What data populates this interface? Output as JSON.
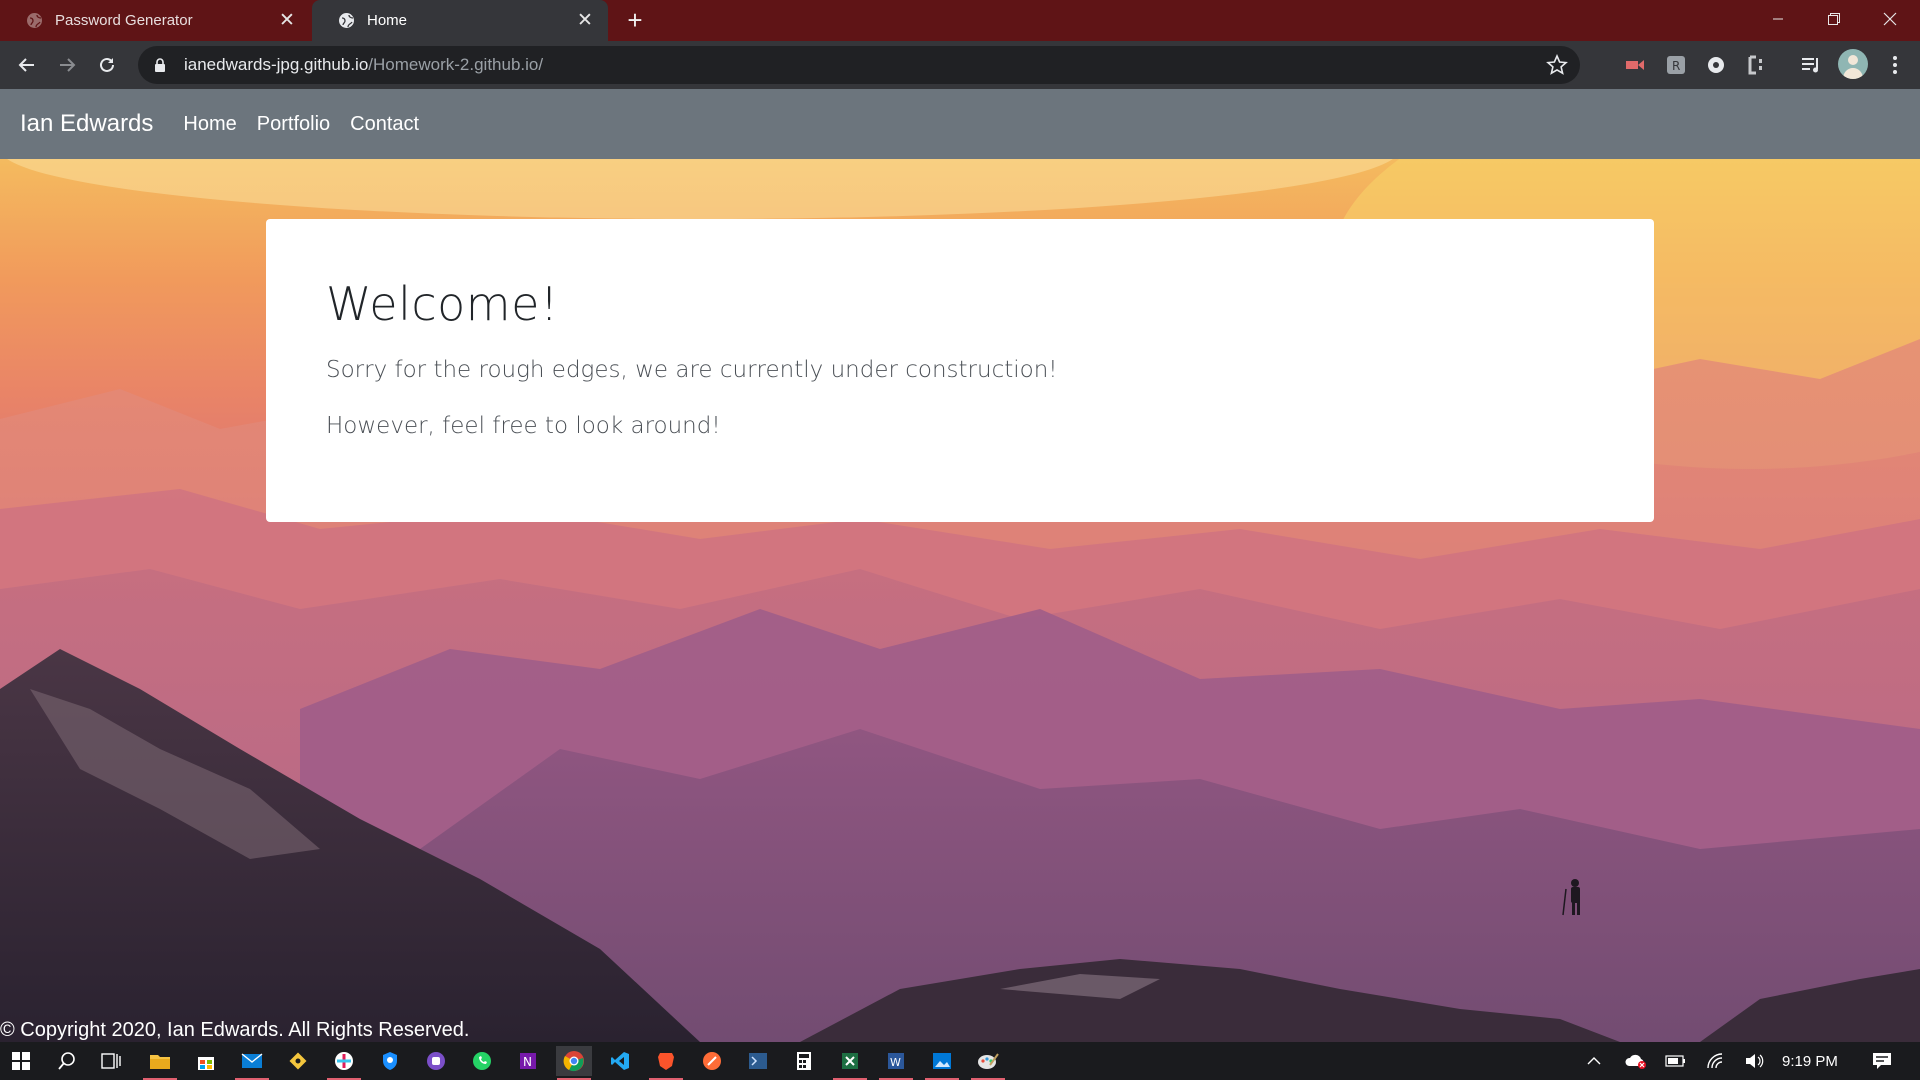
{
  "browser": {
    "tabs": [
      {
        "label": "Password Generator",
        "active": false
      },
      {
        "label": "Home",
        "active": true
      }
    ],
    "new_tab": "+",
    "close_glyph": "✕",
    "address": {
      "host": "ianedwards-jpg.github.io",
      "path": "/Homework-2.github.io/"
    },
    "icons": [
      "back-icon",
      "forward-icon",
      "reload-icon",
      "lock-icon",
      "bookmark-star-icon",
      "extension-icons",
      "media-control-icon",
      "profile-avatar",
      "menu-icon"
    ]
  },
  "site": {
    "brand": "Ian Edwards",
    "nav": [
      "Home",
      "Portfolio",
      "Contact"
    ],
    "card": {
      "heading": "Welcome!",
      "line1": "Sorry for the rough edges, we are currently under construction!",
      "line2": "However, feel free to look around!"
    },
    "footer": "© Copyright 2020, Ian Edwards. All Rights Reserved.",
    "colors": {
      "navbar": "#6c757d",
      "card": "#ffffff"
    }
  },
  "taskbar": {
    "clock": "9:19 PM",
    "apps": [
      "windows-start-icon",
      "search-icon",
      "task-view-icon",
      "file-explorer-icon",
      "store-icon",
      "mail-icon",
      "git-icon",
      "slack-icon",
      "security-icon",
      "app-icon",
      "whatsapp-icon",
      "onenote-icon",
      "chrome-icon",
      "vscode-icon",
      "brave-icon",
      "postman-icon",
      "terminal-icon",
      "calculator-icon",
      "excel-icon",
      "word-icon",
      "photos-icon",
      "paint-icon"
    ]
  }
}
